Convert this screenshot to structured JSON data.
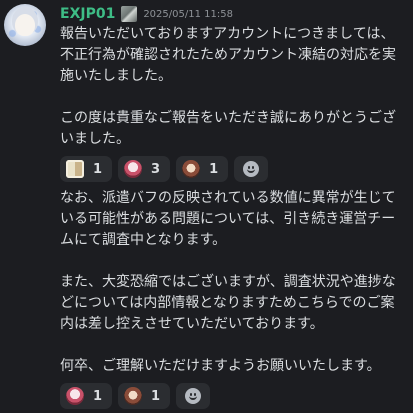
{
  "message": {
    "author": "EXJP01",
    "timestamp": "2025/05/11 11:58",
    "paragraphs_1": [
      "報告いただいておりますアカウントにつきましては、不正行為が確認されたためアカウント凍結の対応を実施いたしました。",
      "この度は貴重なご報告をいただき誠にありがとうございました。"
    ],
    "reactions_1": [
      {
        "emoji": "sticker-emoji",
        "count": "1"
      },
      {
        "emoji": "pink-character-emoji",
        "count": "3"
      },
      {
        "emoji": "brown-character-emoji",
        "count": "1"
      }
    ],
    "paragraphs_2": [
      "なお、派遣バフの反映されている数値に異常が生じている可能性がある問題については、引き続き運営チームにて調査中となります。",
      "また、大変恐縮ではございますが、調査状況や進捗などについては内部情報となりますためこちらでのご案内は差し控えさせていただいております。",
      "何卒、ご理解いただけますようお願いいたします。"
    ],
    "reactions_2": [
      {
        "emoji": "pink-character-emoji",
        "count": "1"
      },
      {
        "emoji": "brown-character-emoji",
        "count": "1"
      }
    ]
  },
  "colors": {
    "background": "#1c1d21",
    "username": "#3ebd86",
    "text": "#dbdee1",
    "reaction_bg": "#2b2d31"
  }
}
